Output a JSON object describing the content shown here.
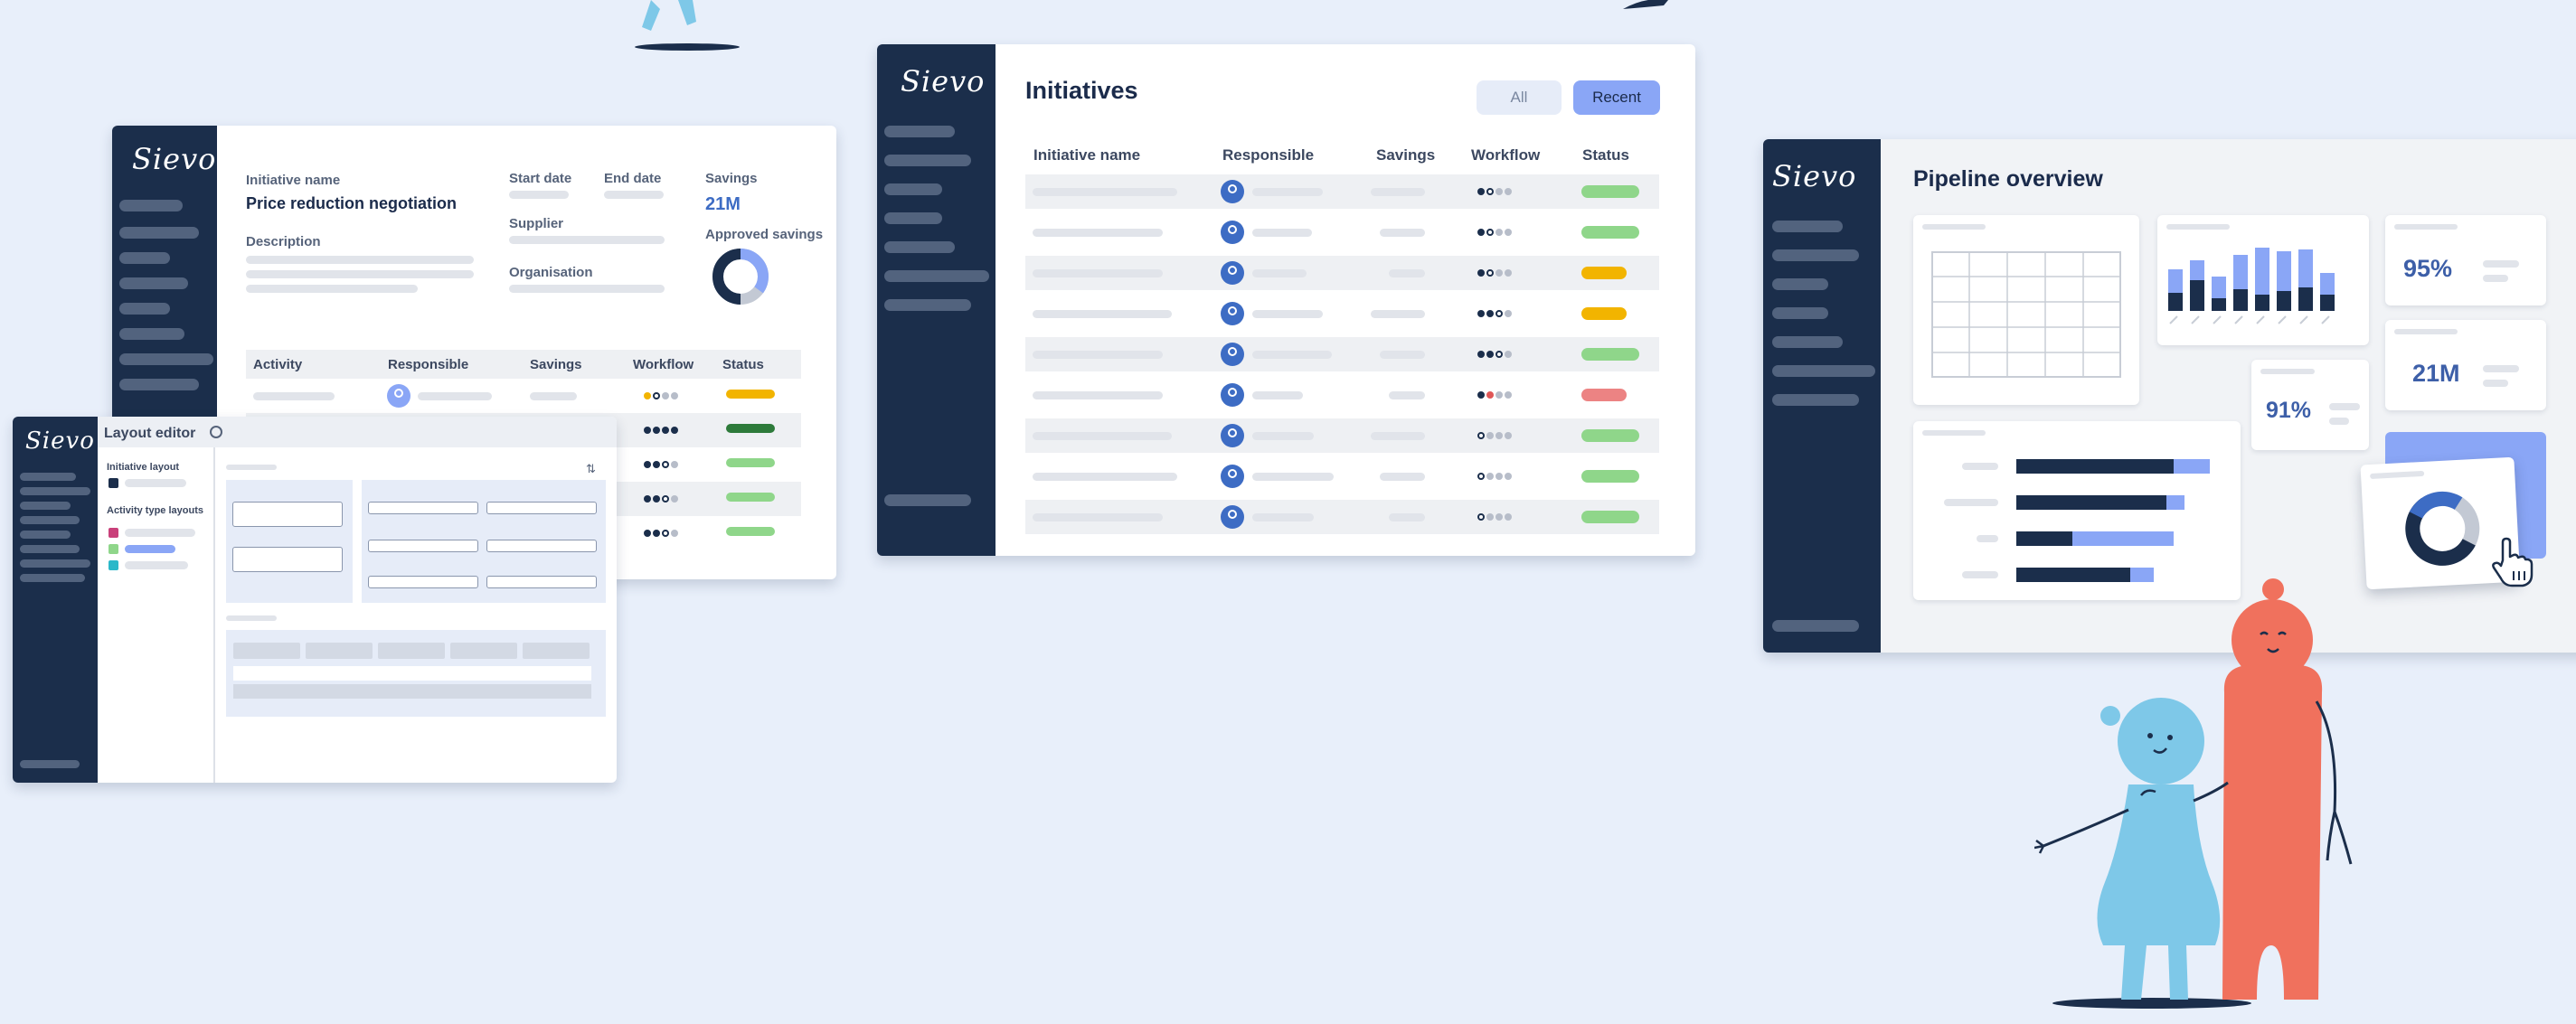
{
  "colors": {
    "navy": "#1b2e4b",
    "accent": "#8aa6f6",
    "green": "#8fd68a",
    "amber": "#f2b400",
    "red": "#ec8383",
    "darkgreen": "#2d7a3a",
    "background": "#e8effa",
    "coral": "#f0715d",
    "sky": "#7ec8e8"
  },
  "brand": {
    "logo_text": "Sievo"
  },
  "initiative_detail": {
    "name_label": "Initiative name",
    "name_value": "Price reduction negotiation",
    "description_label": "Description",
    "start_date_label": "Start date",
    "end_date_label": "End date",
    "supplier_label": "Supplier",
    "organisation_label": "Organisation",
    "savings_label": "Savings",
    "savings_value": "21M",
    "approved_savings_label": "Approved savings",
    "table_headers": [
      "Activity",
      "Responsible",
      "Savings",
      "Workflow",
      "Status"
    ]
  },
  "layout_editor": {
    "title": "Layout editor",
    "initiative_layout_label": "Initiative layout",
    "activity_type_layouts_label": "Activity type layouts",
    "settings_icon": "gear-icon",
    "sliders_icon": "sliders-icon"
  },
  "initiatives": {
    "title": "Initiatives",
    "filter_all": "All",
    "filter_recent": "Recent",
    "headers": [
      "Initiative name",
      "Responsible",
      "Savings",
      "Workflow",
      "Status"
    ],
    "rows": [
      {
        "workflow": [
          "f",
          "o",
          "g",
          "g"
        ],
        "status": "green"
      },
      {
        "workflow": [
          "f",
          "o",
          "g",
          "g"
        ],
        "status": "green"
      },
      {
        "workflow": [
          "f",
          "o",
          "g",
          "g"
        ],
        "status": "amber"
      },
      {
        "workflow": [
          "f",
          "f",
          "o",
          "g"
        ],
        "status": "amber"
      },
      {
        "workflow": [
          "f",
          "f",
          "o",
          "g"
        ],
        "status": "green"
      },
      {
        "workflow": [
          "f",
          "r",
          "g",
          "g"
        ],
        "status": "red"
      },
      {
        "workflow": [
          "o",
          "g",
          "g",
          "g"
        ],
        "status": "green"
      },
      {
        "workflow": [
          "o",
          "g",
          "g",
          "g"
        ],
        "status": "green"
      },
      {
        "workflow": [
          "o",
          "g",
          "g",
          "g"
        ],
        "status": "green"
      }
    ]
  },
  "pipeline": {
    "title": "Pipeline overview",
    "kpi_1": "95%",
    "kpi_2": "21M",
    "kpi_3": "91%"
  }
}
